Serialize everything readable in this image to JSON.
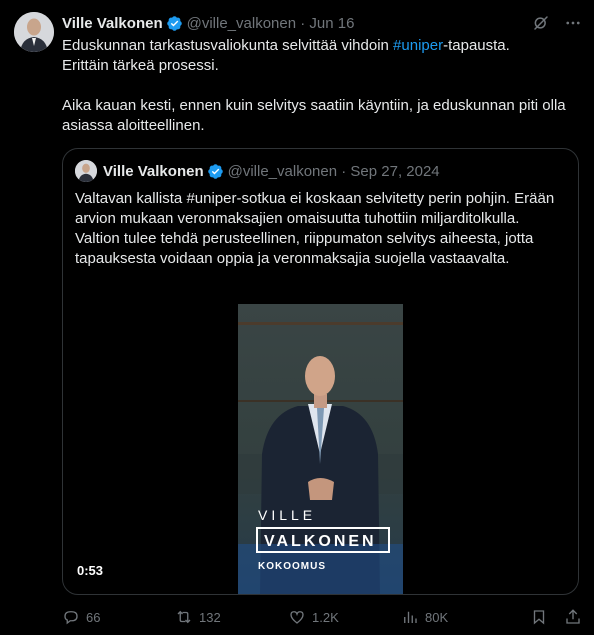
{
  "post": {
    "author": {
      "name": "Ville Valkonen",
      "handle": "@ville_valkonen",
      "date": "Jun 16"
    },
    "text": {
      "line1_before": "Eduskunnan tarkastusvaliokunta selvittää vihdoin ",
      "hashtag": "#uniper",
      "line1_after": "-tapausta.",
      "line2": "Erittäin tärkeä prosessi.",
      "para2": "Aika kauan kesti, ennen kuin selvitys saatiin käyntiin, ja eduskunnan piti olla asiassa aloitteellinen."
    },
    "quoted": {
      "author": {
        "name": "Ville Valkonen",
        "handle": "@ville_valkonen",
        "date": "Sep 27, 2024"
      },
      "text": "Valtavan kallista #uniper-sotkua ei koskaan selvitetty perin pohjin. Erään arvion mukaan veronmaksajien omaisuutta tuhottiin miljarditolkulla. Valtion tulee tehdä perusteellinen, riippumaton selvitys aiheesta, jotta tapauksesta voidaan oppia ja veronmaksajia suojella vastaavalta.",
      "video": {
        "overlay_top": "VILLE",
        "overlay_name": "VALKONEN",
        "overlay_party": "KOKOOMUS",
        "duration": "0:53"
      }
    },
    "actions": {
      "replies": "66",
      "reposts": "132",
      "likes": "1.2K",
      "views": "80K"
    }
  },
  "colors": {
    "accent": "#1d9bf0",
    "muted": "#71767b",
    "background": "#000000",
    "text": "#e7e9ea"
  },
  "icons": [
    "grok-icon",
    "more-icon",
    "verified-icon",
    "reply-icon",
    "repost-icon",
    "like-icon",
    "views-icon",
    "bookmark-icon",
    "share-icon"
  ]
}
